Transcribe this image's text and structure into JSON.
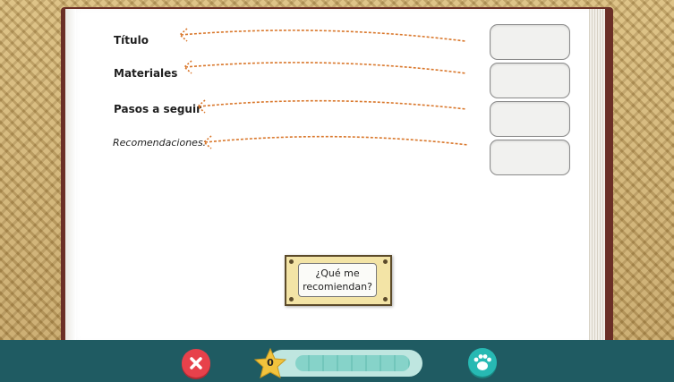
{
  "labels": {
    "titulo": "Título",
    "materiales": "Materiales",
    "pasos": "Pasos a seguir",
    "recomendaciones": "Recomendaciones:"
  },
  "note_button": {
    "line1": "¿Qué me",
    "line2": "recomiendan?"
  },
  "progress": {
    "score": "0",
    "fraction": 0
  },
  "icons": {
    "close": "close-icon",
    "star": "star-icon",
    "paw": "paw-icon"
  },
  "colors": {
    "bottom_bar": "#1f5b62",
    "close_button": "#e7414b",
    "paw_button": "#27b9b3",
    "arrow": "#d9772b"
  }
}
